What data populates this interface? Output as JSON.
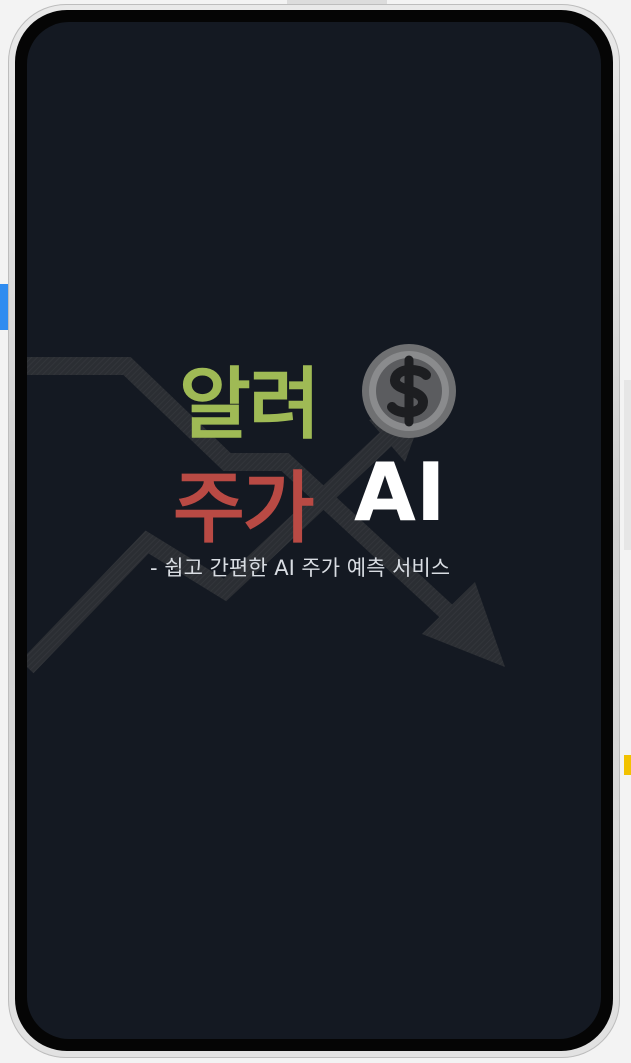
{
  "app": {
    "logo": {
      "line1": "알려",
      "line2_korean": "주가",
      "line2_latin": "AI",
      "coin_symbol": "$",
      "line1_color": "#9fba55",
      "line2_color": "#b94a44",
      "latin_color": "#ffffff"
    },
    "tagline": "- 쉽고 간편한 AI 주가 예측 서비스",
    "screen_background": "#141922"
  },
  "icons": {
    "coin": "dollar-coin-icon",
    "arrows": "stock-trend-arrows-icon"
  }
}
